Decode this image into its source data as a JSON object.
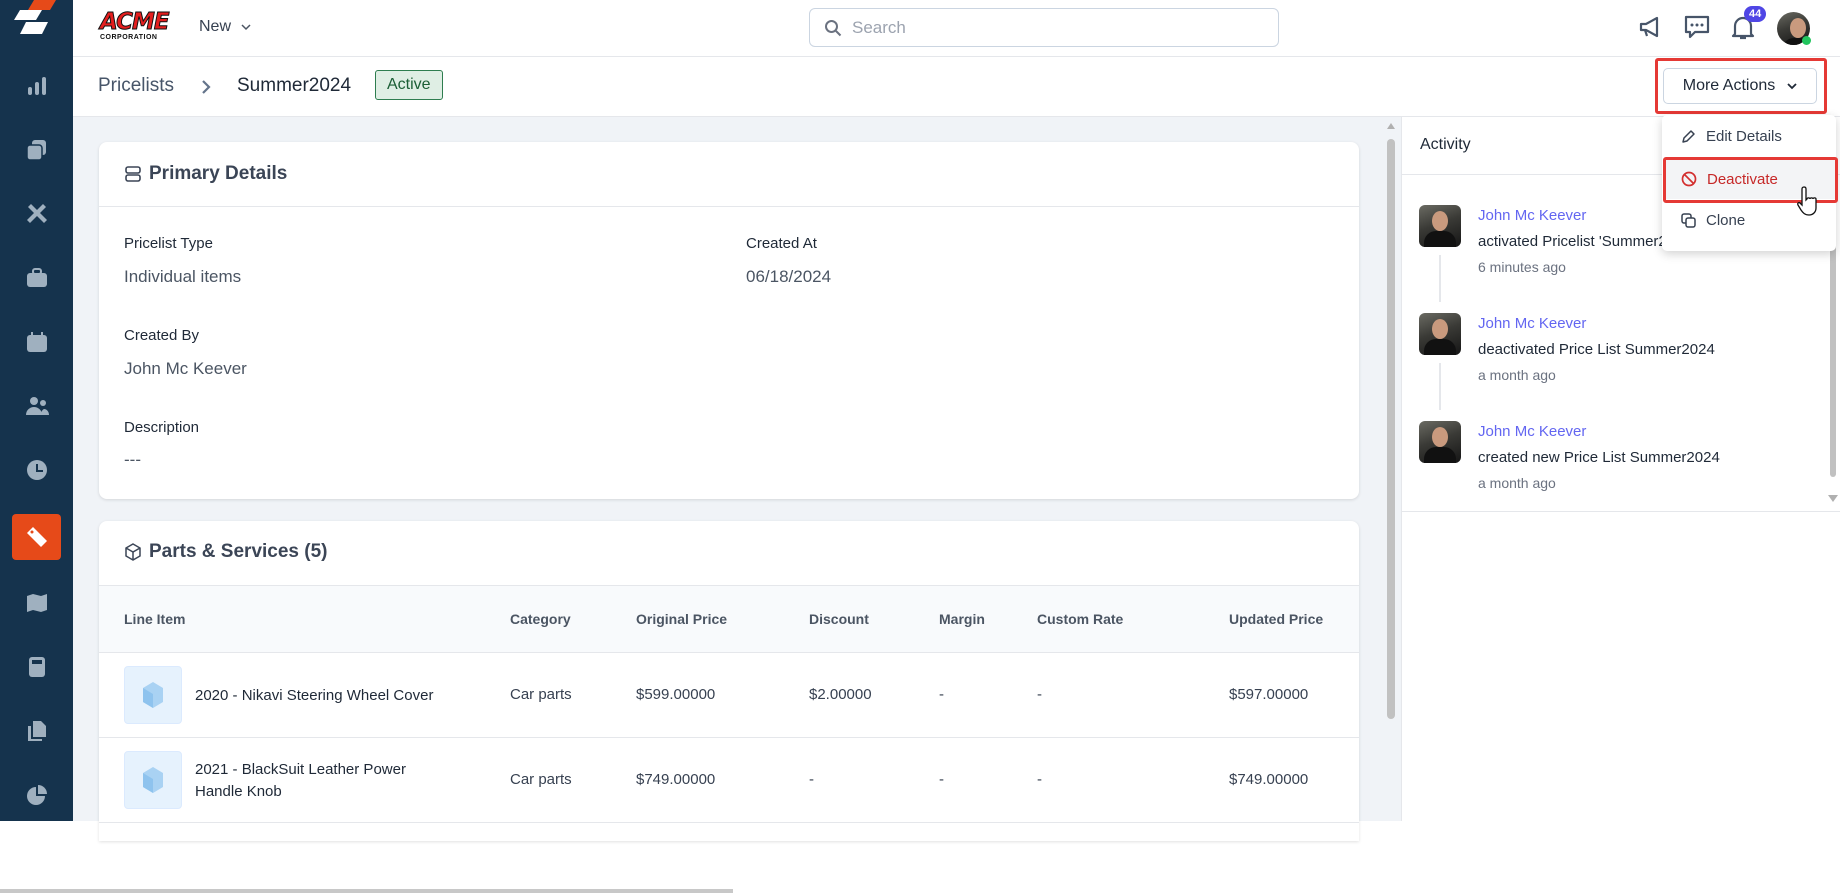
{
  "topbar": {
    "logo_text": "ACME",
    "logo_sub": "CORPORATION",
    "new_label": "New",
    "search_placeholder": "Search",
    "notification_count": "44"
  },
  "sidebar": {
    "items": [
      {
        "icon": "chart-bar-icon"
      },
      {
        "icon": "clipboard-check-icon"
      },
      {
        "icon": "tools-icon"
      },
      {
        "icon": "briefcase-icon"
      },
      {
        "icon": "calendar-icon"
      },
      {
        "icon": "users-icon"
      },
      {
        "icon": "clock-icon"
      },
      {
        "icon": "tag-icon",
        "active": true
      },
      {
        "icon": "map-icon"
      },
      {
        "icon": "calculator-icon"
      },
      {
        "icon": "files-icon"
      },
      {
        "icon": "pie-chart-icon"
      }
    ],
    "active_color": "#e64a19"
  },
  "breadcrumb": {
    "root": "Pricelists",
    "current": "Summer2024",
    "status": "Active"
  },
  "actions": {
    "more_label": "More Actions",
    "menu": [
      {
        "label": "Edit Details",
        "icon": "pencil-icon"
      },
      {
        "label": "Deactivate",
        "icon": "ban-icon"
      },
      {
        "label": "Clone",
        "icon": "copy-icon"
      }
    ]
  },
  "primary": {
    "title": "Primary Details",
    "fields": {
      "type_label": "Pricelist Type",
      "type_value": "Individual items",
      "created_at_label": "Created At",
      "created_at_value": "06/18/2024",
      "created_by_label": "Created By",
      "created_by_value": "John Mc Keever",
      "description_label": "Description",
      "description_value": "---"
    }
  },
  "parts": {
    "title": "Parts & Services (5)",
    "columns": [
      "Line Item",
      "Category",
      "Original Price",
      "Discount",
      "Margin",
      "Custom Rate",
      "Updated Price"
    ],
    "rows": [
      [
        "2020 - Nikavi Steering Wheel Cover",
        "Car parts",
        "$599.00000",
        "$2.00000",
        "-",
        "-",
        "$597.00000"
      ],
      [
        "2021 - BlackSuit Leather Power Handle Knob",
        "Car parts",
        "$749.00000",
        "-",
        "-",
        "-",
        "$749.00000"
      ]
    ]
  },
  "activity": {
    "title": "Activity",
    "items": [
      {
        "user": "John Mc Keever",
        "text": "activated Pricelist 'Summer2024'",
        "time": "6 minutes ago"
      },
      {
        "user": "John Mc Keever",
        "text": "deactivated Price List Summer2024",
        "time": "a month ago"
      },
      {
        "user": "John Mc Keever",
        "text": "created new Price List Summer2024",
        "time": "a month ago"
      }
    ]
  }
}
